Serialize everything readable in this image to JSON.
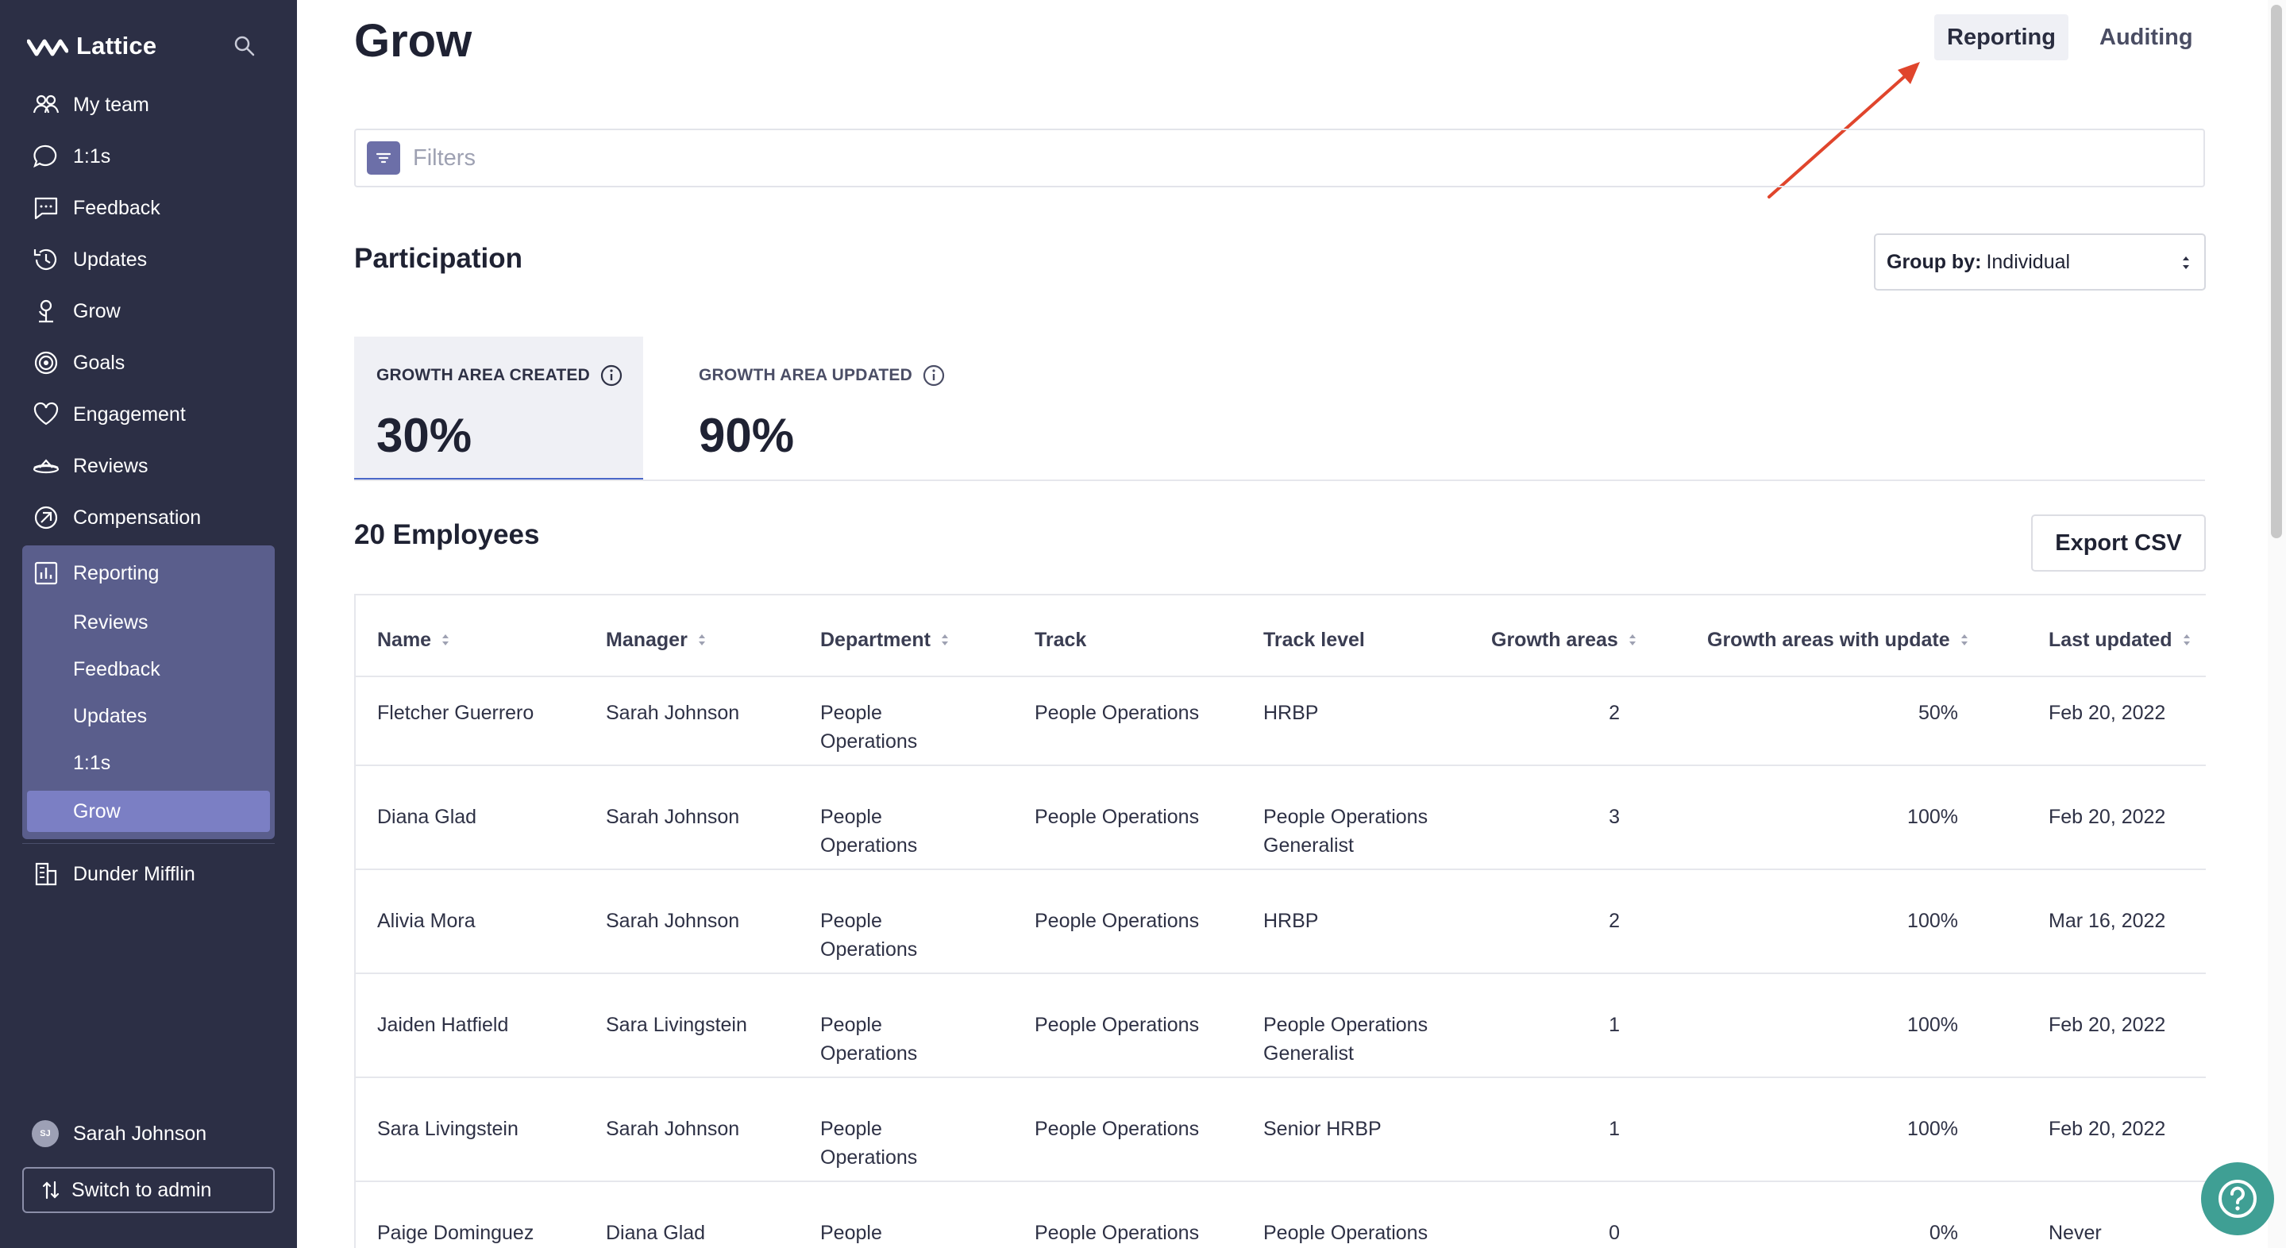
{
  "sidebar": {
    "brand": "Lattice",
    "items": [
      {
        "label": "My team",
        "icon": "people-icon"
      },
      {
        "label": "1:1s",
        "icon": "chat-bubble-icon"
      },
      {
        "label": "Feedback",
        "icon": "message-square-icon"
      },
      {
        "label": "Updates",
        "icon": "updates-icon"
      },
      {
        "label": "Grow",
        "icon": "grow-icon"
      },
      {
        "label": "Goals",
        "icon": "target-icon"
      },
      {
        "label": "Engagement",
        "icon": "heart-icon"
      },
      {
        "label": "Reviews",
        "icon": "reviews-icon"
      },
      {
        "label": "Compensation",
        "icon": "compensation-icon"
      }
    ],
    "reporting": {
      "label": "Reporting",
      "subitems": [
        "Reviews",
        "Feedback",
        "Updates",
        "1:1s",
        "Grow"
      ],
      "active": "Grow"
    },
    "company": "Dunder Mifflin",
    "user": {
      "initials": "SJ",
      "name": "Sarah Johnson"
    },
    "switch_label": "Switch to admin"
  },
  "header": {
    "title": "Grow",
    "tabs": [
      "Reporting",
      "Auditing"
    ],
    "active_tab": "Reporting"
  },
  "filters": {
    "placeholder": "Filters"
  },
  "participation": {
    "title": "Participation",
    "group_by_label": "Group by:",
    "group_by_value": "Individual",
    "metrics": [
      {
        "label": "GROWTH AREA CREATED",
        "value": "30%"
      },
      {
        "label": "GROWTH AREA UPDATED",
        "value": "90%"
      }
    ]
  },
  "employees": {
    "count_label": "20 Employees",
    "export_label": "Export CSV",
    "columns": [
      "Name",
      "Manager",
      "Department",
      "Track",
      "Track level",
      "Growth areas",
      "Growth areas with update",
      "Last updated"
    ],
    "rows": [
      {
        "name": "Fletcher Guerrero",
        "manager": "Sarah Johnson",
        "dept1": "People",
        "dept2": "Operations",
        "track": "People Operations",
        "level1": "HRBP",
        "level2": "",
        "areas": "2",
        "pct": "50%",
        "updated": "Feb 20, 2022"
      },
      {
        "name": "Diana Glad",
        "manager": "Sarah Johnson",
        "dept1": "People",
        "dept2": "Operations",
        "track": "People Operations",
        "level1": "People Operations",
        "level2": "Generalist",
        "areas": "3",
        "pct": "100%",
        "updated": "Feb 20, 2022"
      },
      {
        "name": "Alivia Mora",
        "manager": "Sarah Johnson",
        "dept1": "People",
        "dept2": "Operations",
        "track": "People Operations",
        "level1": "HRBP",
        "level2": "",
        "areas": "2",
        "pct": "100%",
        "updated": "Mar 16, 2022"
      },
      {
        "name": "Jaiden Hatfield",
        "manager": "Sara Livingstein",
        "dept1": "People",
        "dept2": "Operations",
        "track": "People Operations",
        "level1": "People Operations",
        "level2": "Generalist",
        "areas": "1",
        "pct": "100%",
        "updated": "Feb 20, 2022"
      },
      {
        "name": "Sara Livingstein",
        "manager": "Sarah Johnson",
        "dept1": "People",
        "dept2": "Operations",
        "track": "People Operations",
        "level1": "Senior HRBP",
        "level2": "",
        "areas": "1",
        "pct": "100%",
        "updated": "Feb 20, 2022"
      },
      {
        "name": "Paige Dominguez",
        "manager": "Diana Glad",
        "dept1": "People",
        "dept2": "",
        "track": "People Operations",
        "level1": "People Operations",
        "level2": "",
        "areas": "0",
        "pct": "0%",
        "updated": "Never"
      }
    ]
  },
  "colors": {
    "sidebar_bg": "#2c2f45",
    "reporting_group_bg": "#5a5e8c",
    "active_item_bg": "#7b7fc4",
    "accent_underline": "#4a67c8",
    "annotation_arrow": "#e0452c",
    "help_button": "#3f9f94"
  }
}
